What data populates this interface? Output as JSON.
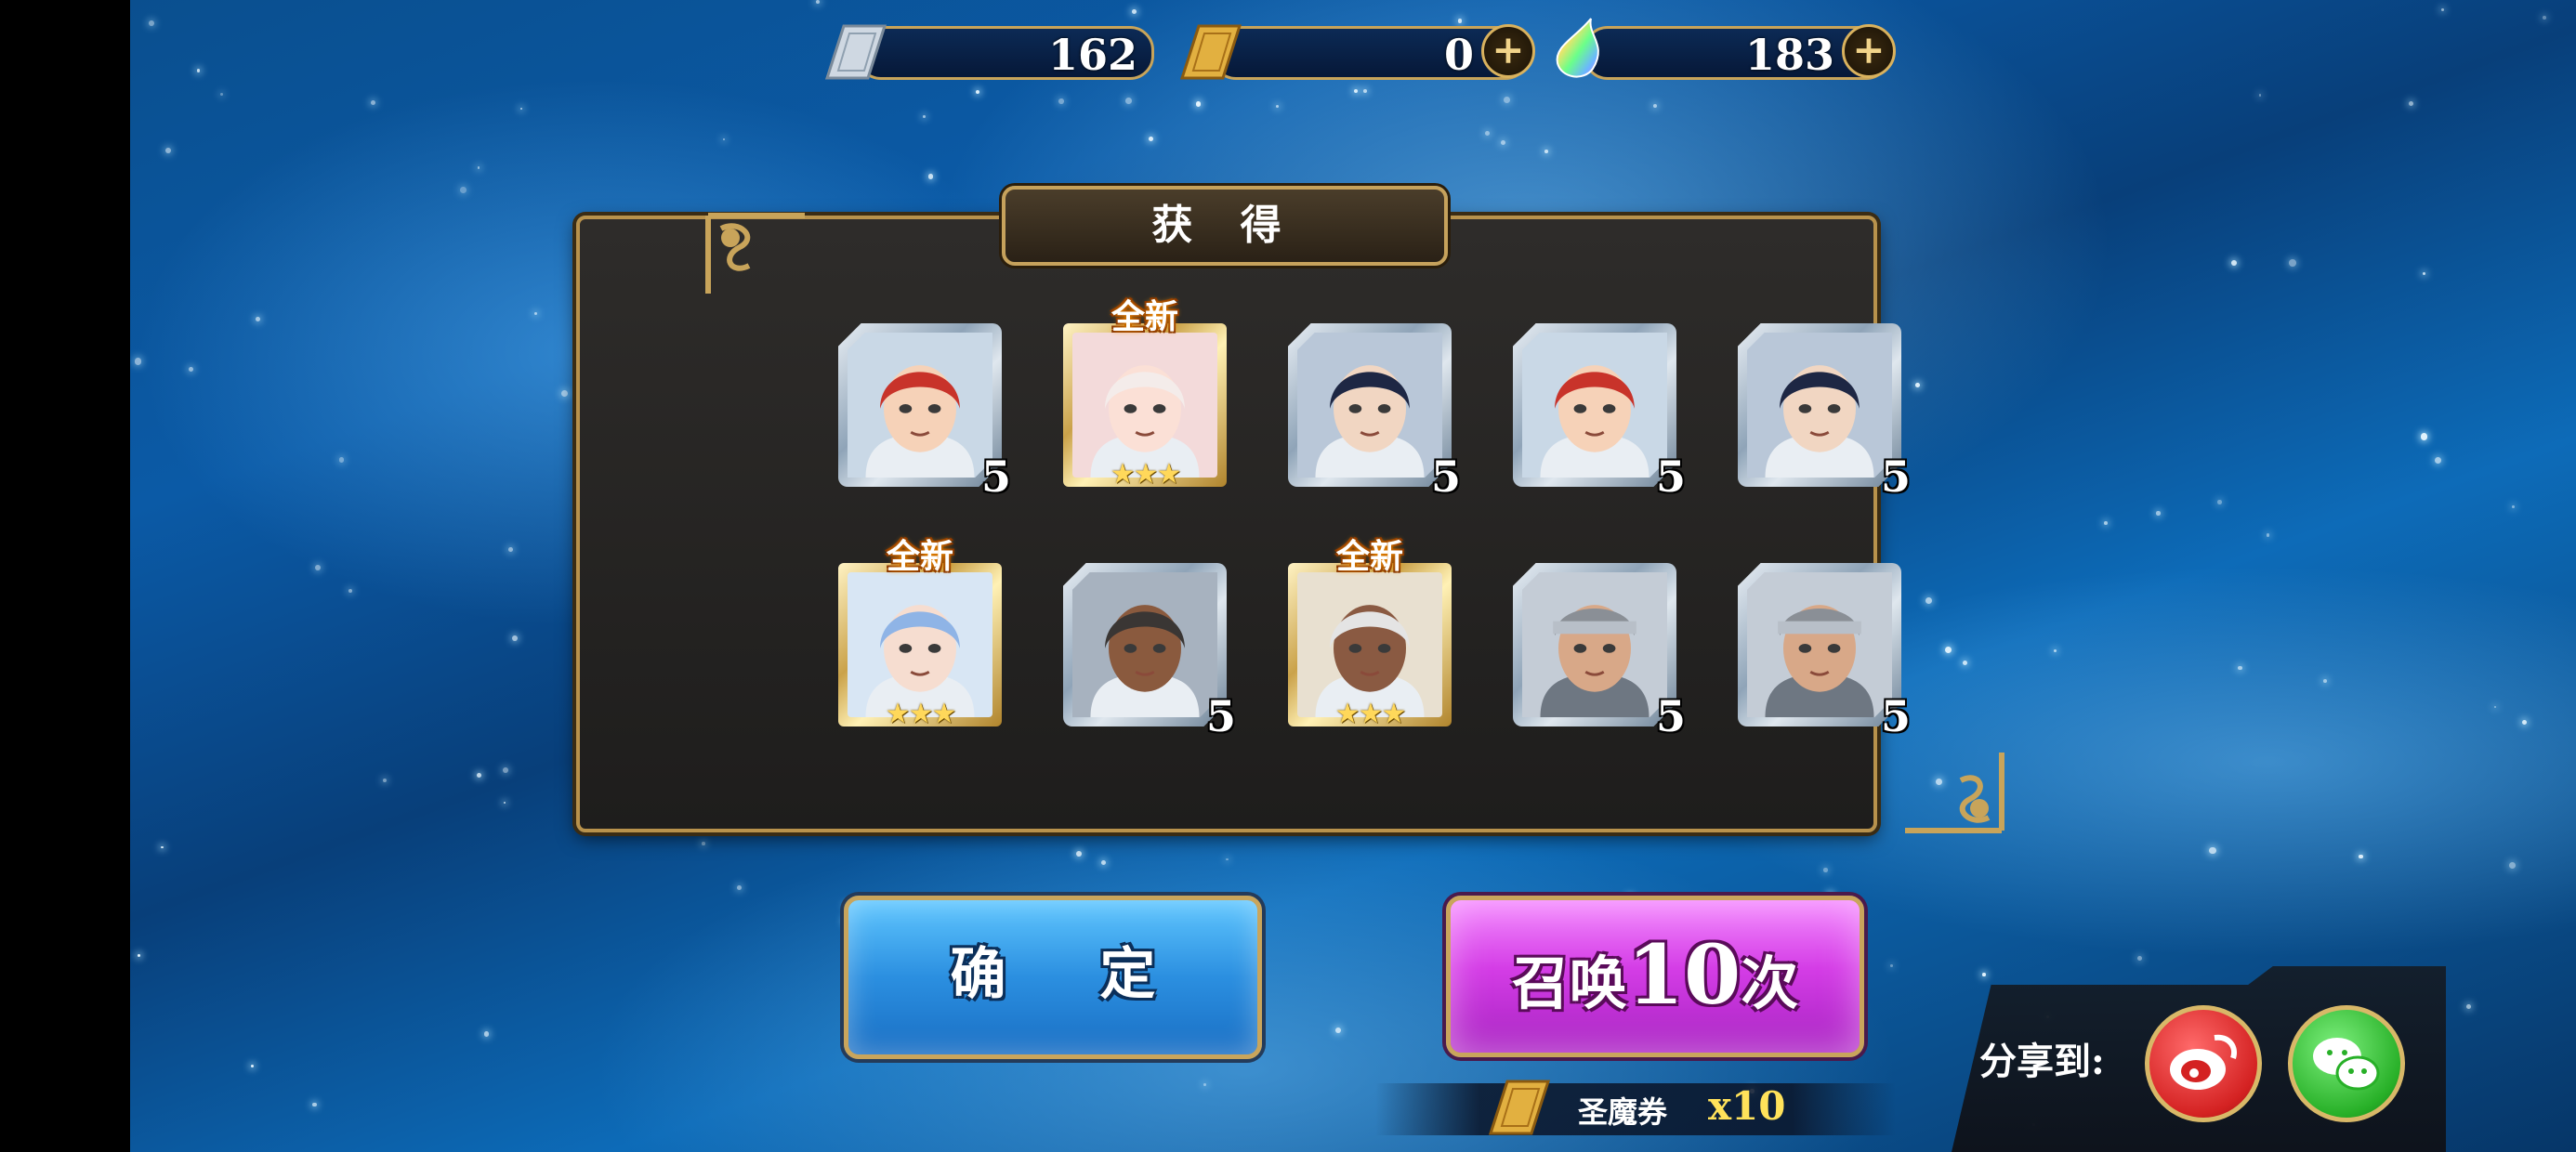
{
  "currencies": [
    {
      "name": "ticket",
      "value": "162",
      "has_plus": false
    },
    {
      "name": "gold-ticket",
      "value": "0",
      "has_plus": true
    },
    {
      "name": "crystal",
      "value": "183",
      "has_plus": true
    }
  ],
  "panel": {
    "title": "获 得",
    "cards": [
      {
        "character": "red-haired-girl",
        "frame": "silver",
        "number": "5",
        "is_new": false,
        "stars": ""
      },
      {
        "character": "white-haired-girl",
        "frame": "gold",
        "number": "",
        "is_new": true,
        "stars": "★★★"
      },
      {
        "character": "dark-haired-man",
        "frame": "silver",
        "number": "5",
        "is_new": false,
        "stars": ""
      },
      {
        "character": "red-haired-girl",
        "frame": "silver",
        "number": "5",
        "is_new": false,
        "stars": ""
      },
      {
        "character": "dark-haired-man",
        "frame": "silver",
        "number": "5",
        "is_new": false,
        "stars": ""
      },
      {
        "character": "blue-haired-girl",
        "frame": "gold",
        "number": "",
        "is_new": true,
        "stars": "★★★"
      },
      {
        "character": "old-bearded-man",
        "frame": "silver",
        "number": "5",
        "is_new": false,
        "stars": ""
      },
      {
        "character": "silver-haired-girl",
        "frame": "gold",
        "number": "",
        "is_new": true,
        "stars": "★★★"
      },
      {
        "character": "helmeted-knight",
        "frame": "silver",
        "number": "5",
        "is_new": false,
        "stars": ""
      },
      {
        "character": "helmeted-knight",
        "frame": "silver",
        "number": "5",
        "is_new": false,
        "stars": ""
      }
    ],
    "new_label": "全新"
  },
  "buttons": {
    "confirm": "确 定",
    "summon_prefix": "召唤",
    "summon_number": "10",
    "summon_suffix": "次"
  },
  "cost": {
    "item": "圣魔券",
    "count": "x10"
  },
  "share": {
    "label": "分享到:",
    "targets": [
      "weibo-icon",
      "wechat-icon"
    ]
  },
  "colors": {
    "gold_border": "#c6a25c",
    "confirm_blue": "#2b8fe0",
    "summon_magenta": "#d43de6",
    "count_yellow": "#ffe25a"
  }
}
